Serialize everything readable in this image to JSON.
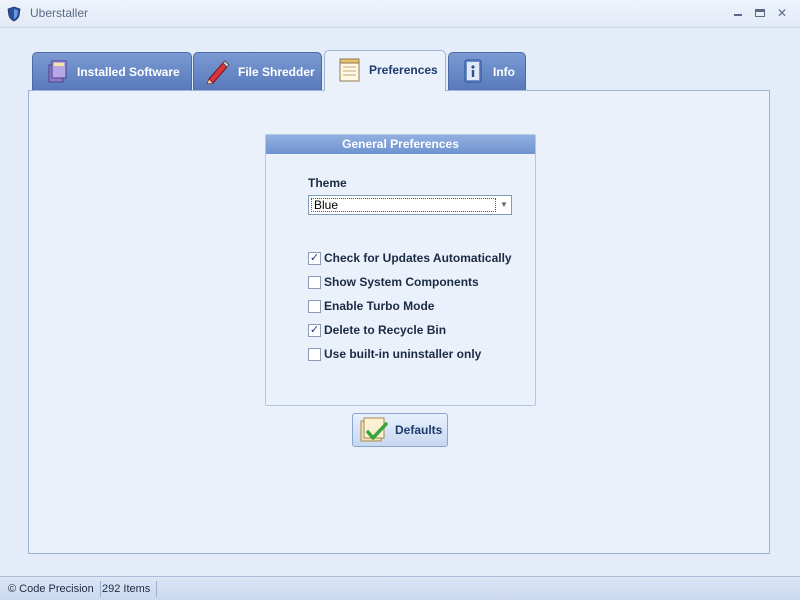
{
  "window": {
    "title": "Uberstaller"
  },
  "tabs": [
    {
      "label": "Installed Software",
      "icon": "installer-box-icon",
      "active": false
    },
    {
      "label": "File Shredder",
      "icon": "shredder-pencil-icon",
      "active": false
    },
    {
      "label": "Preferences",
      "icon": "preferences-notepad-icon",
      "active": true
    },
    {
      "label": "Info",
      "icon": "info-icon",
      "active": false
    }
  ],
  "preferences": {
    "group_title": "General Preferences",
    "theme_label": "Theme",
    "theme_value": "Blue",
    "options": [
      {
        "label": "Check for Updates Automatically",
        "checked": true
      },
      {
        "label": "Show System Components",
        "checked": false
      },
      {
        "label": "Enable Turbo Mode",
        "checked": false
      },
      {
        "label": "Delete to Recycle Bin",
        "checked": true
      },
      {
        "label": "Use built-in uninstaller only",
        "checked": false
      }
    ],
    "defaults_label": "Defaults"
  },
  "statusbar": {
    "copyright": "© Code Precision",
    "items": "292 Items"
  },
  "colors": {
    "accent": "#5879bb",
    "panel_bg": "#eaf1fb",
    "header": "#7f9fd6"
  }
}
